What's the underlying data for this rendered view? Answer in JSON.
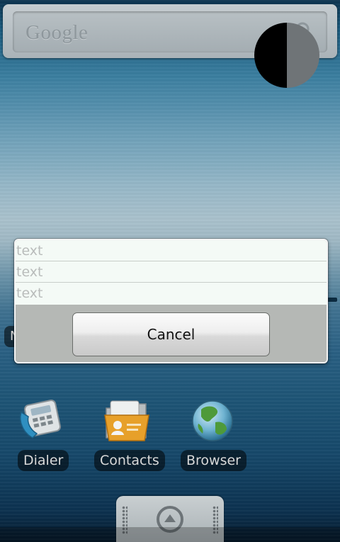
{
  "home": {
    "search_widget": {
      "logo_text": "Google",
      "search_icon": "magnifier-icon"
    },
    "overlay_circle": {
      "colors": [
        "#000000",
        "#6f7477"
      ]
    },
    "partial_label": "N",
    "apps": [
      {
        "label": "Dialer",
        "icon": "phone-icon"
      },
      {
        "label": "Contacts",
        "icon": "contacts-folder-icon"
      },
      {
        "label": "Browser",
        "icon": "globe-icon"
      }
    ],
    "drawer": {
      "icon": "up-arrow-icon"
    }
  },
  "dialog": {
    "fields": [
      {
        "placeholder": "text"
      },
      {
        "placeholder": "text"
      },
      {
        "placeholder": "text"
      }
    ],
    "cancel_label": "Cancel"
  },
  "colors": {
    "dialog_background": "#b5b8b5",
    "field_background": "#f4faf6",
    "placeholder_text": "#b9bcbb"
  }
}
